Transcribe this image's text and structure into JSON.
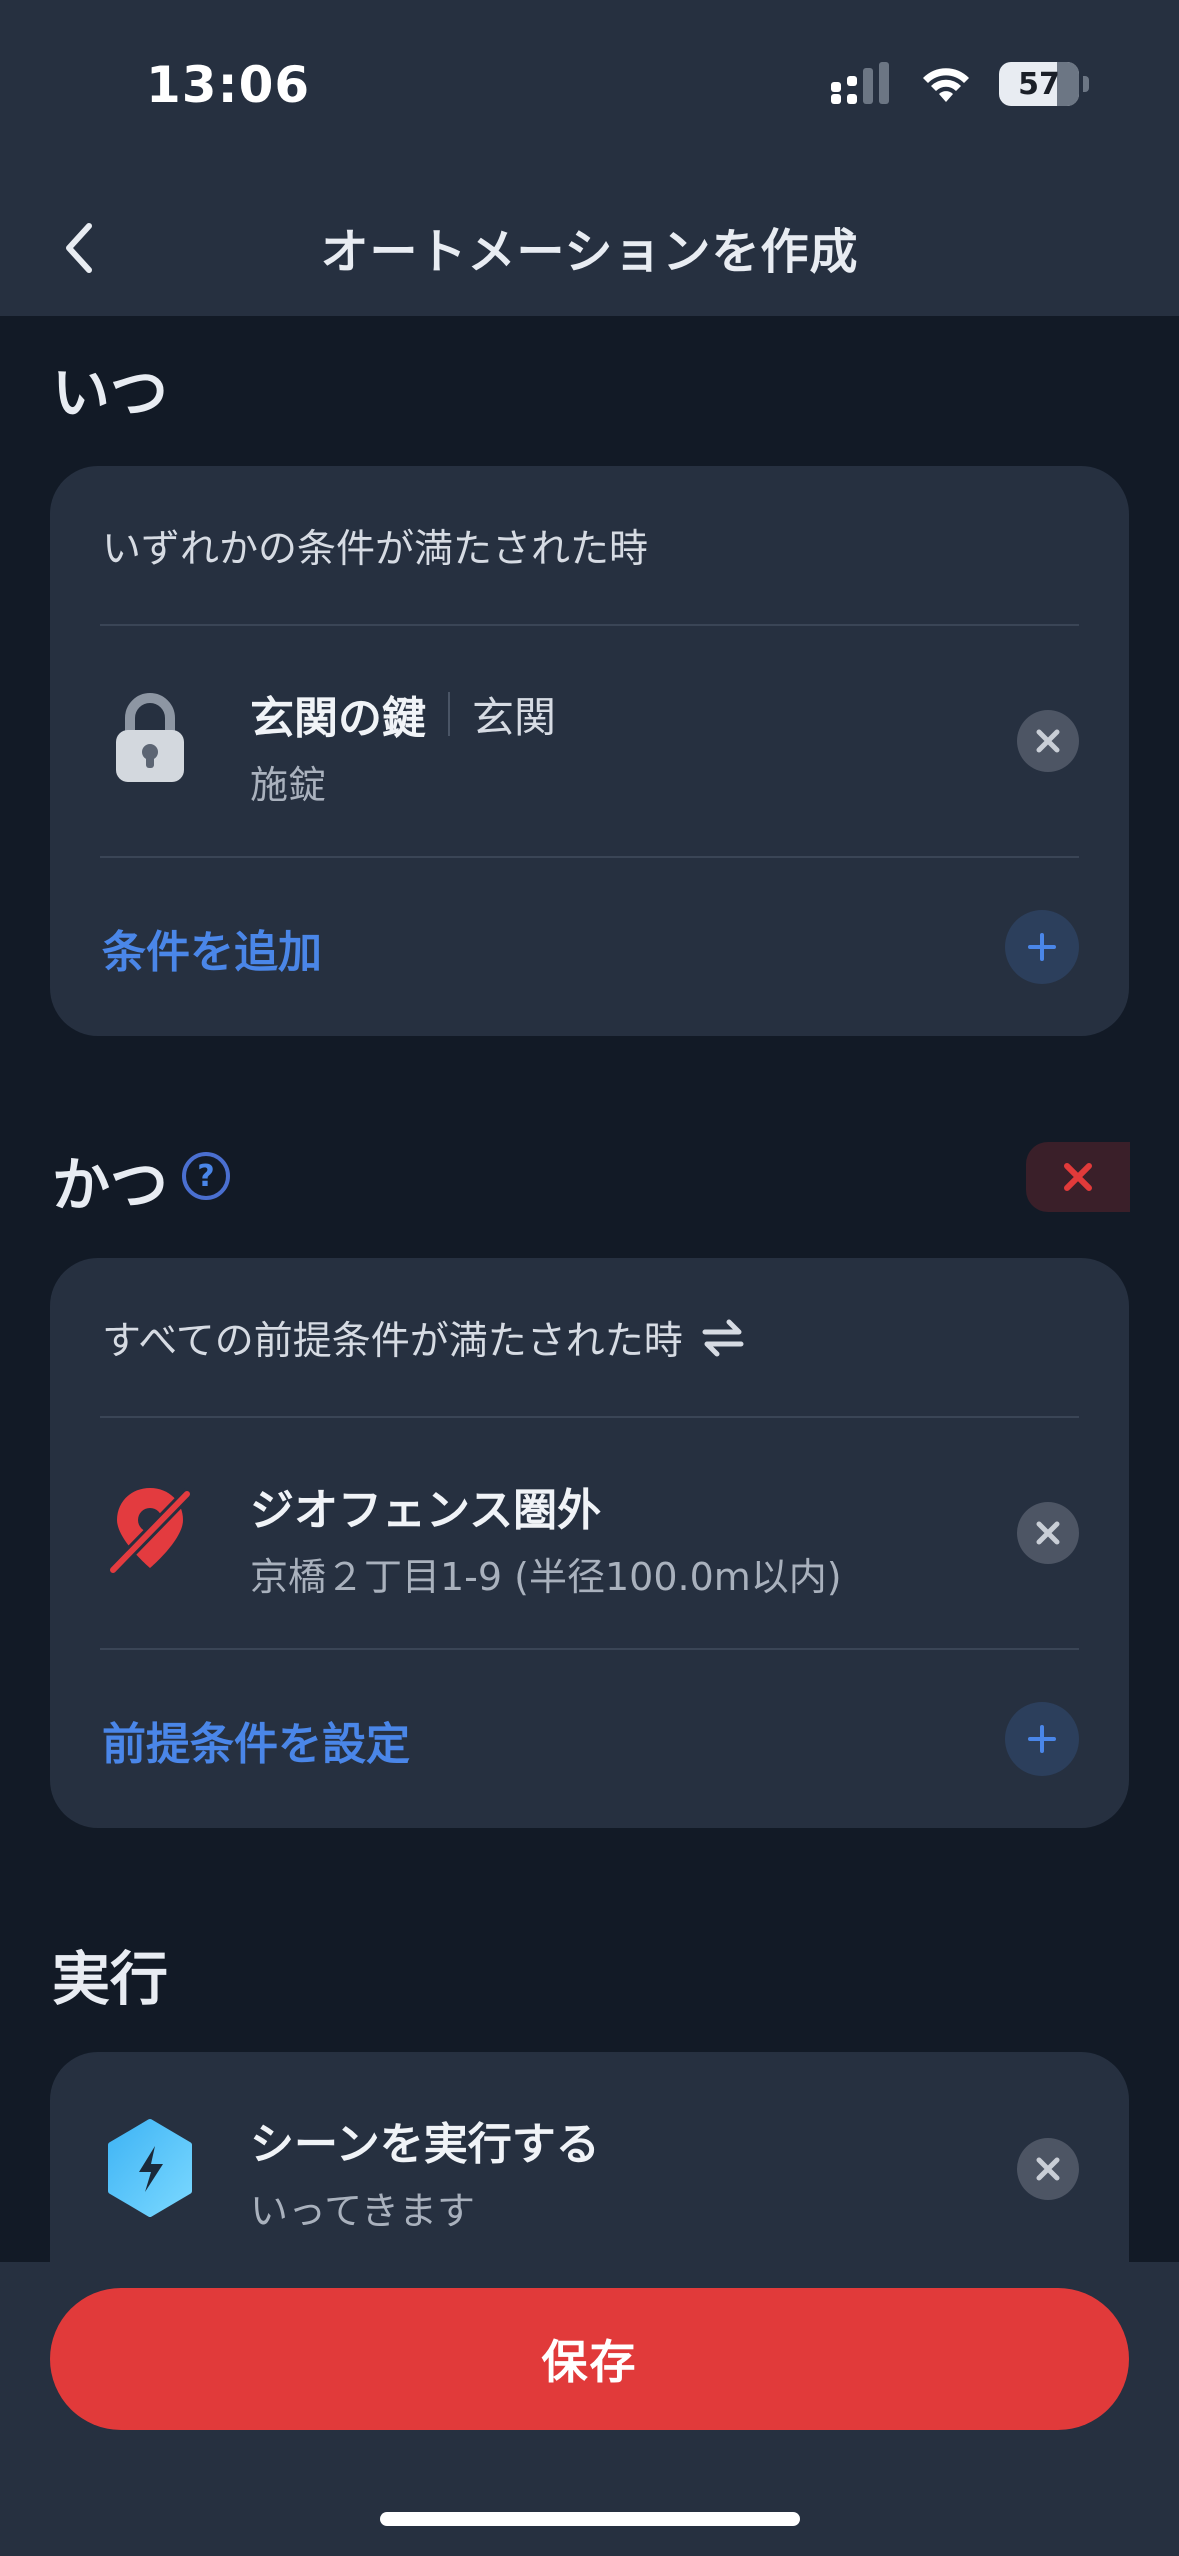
{
  "status_bar": {
    "time": "13:06",
    "battery": "57"
  },
  "header": {
    "title": "オートメーションを作成"
  },
  "when": {
    "title": "いつ",
    "card_head": "いずれかの条件が満たされた時",
    "item": {
      "name": "玄関の鍵",
      "room": "玄関",
      "state": "施錠"
    },
    "add_label": "条件を追加"
  },
  "and": {
    "title": "かつ",
    "help": "?",
    "card_head": "すべての前提条件が満たされた時",
    "item": {
      "name": "ジオフェンス圏外",
      "detail": "京橋２丁目1-9 (半径100.0m以内)"
    },
    "add_label": "前提条件を設定"
  },
  "action": {
    "title": "実行",
    "item": {
      "name": "シーンを実行する",
      "detail": "いってきます"
    }
  },
  "save_label": "保存",
  "colors": {
    "accent": "#4a86e8",
    "danger": "#e13a3a",
    "card": "#263040",
    "background": "#121a26"
  }
}
